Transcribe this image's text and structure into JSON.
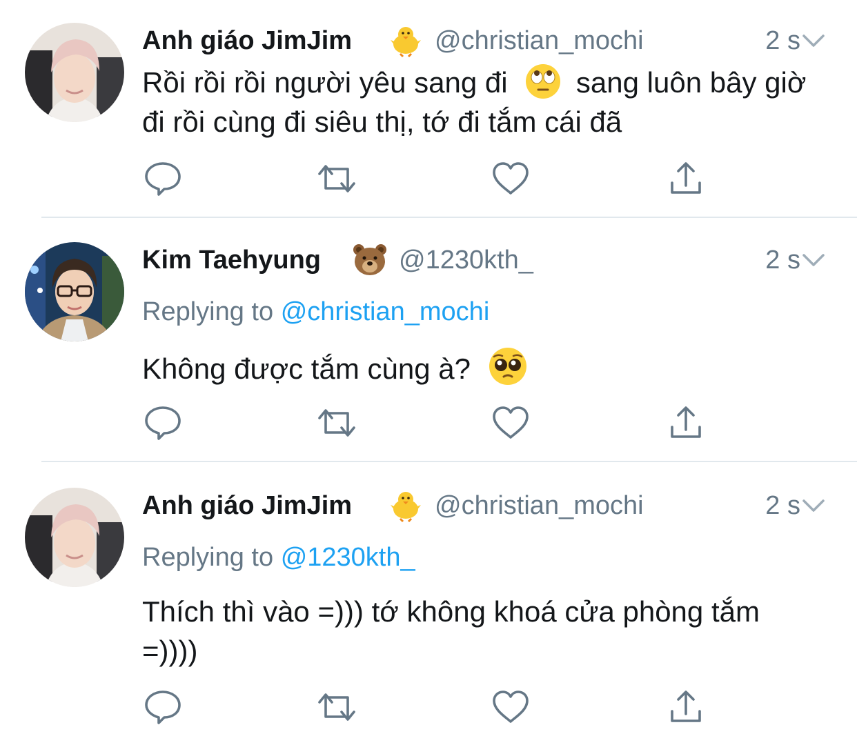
{
  "tweets": [
    {
      "display_name": "Anh giáo JimJim",
      "name_emoji": "baby-chick",
      "handle": "@christian_mochi",
      "time": "2 s",
      "replying_prefix": "",
      "replying_to": "",
      "text_part1": "Rồi rồi rồi người yêu sang đi",
      "text_emoji": "face-with-rolling-eyes",
      "text_part2": "sang luôn bây giờ đi rồi cùng đi siêu thị, tớ đi tắm cái đã"
    },
    {
      "display_name": "Kim Taehyung",
      "name_emoji": "bear-face",
      "handle": "@1230kth_",
      "time": "2 s",
      "replying_prefix": "Replying to",
      "replying_to": "@christian_mochi",
      "text_part1": "Không được tắm cùng à?",
      "text_emoji": "pleading-face",
      "text_part2": ""
    },
    {
      "display_name": "Anh giáo JimJim",
      "name_emoji": "baby-chick",
      "handle": "@christian_mochi",
      "time": "2 s",
      "replying_prefix": "Replying to",
      "replying_to": "@1230kth_",
      "text_part1": "Thích thì vào =))) tớ không khoá cửa phòng tắm =))))",
      "text_emoji": "",
      "text_part2": ""
    }
  ],
  "colors": {
    "text": "#14171a",
    "secondary": "#657786",
    "link": "#1da1f2",
    "icon": "#657786",
    "divider": "#e1e8ed"
  },
  "action_icons": [
    "reply-icon",
    "retweet-icon",
    "like-icon",
    "share-icon"
  ]
}
